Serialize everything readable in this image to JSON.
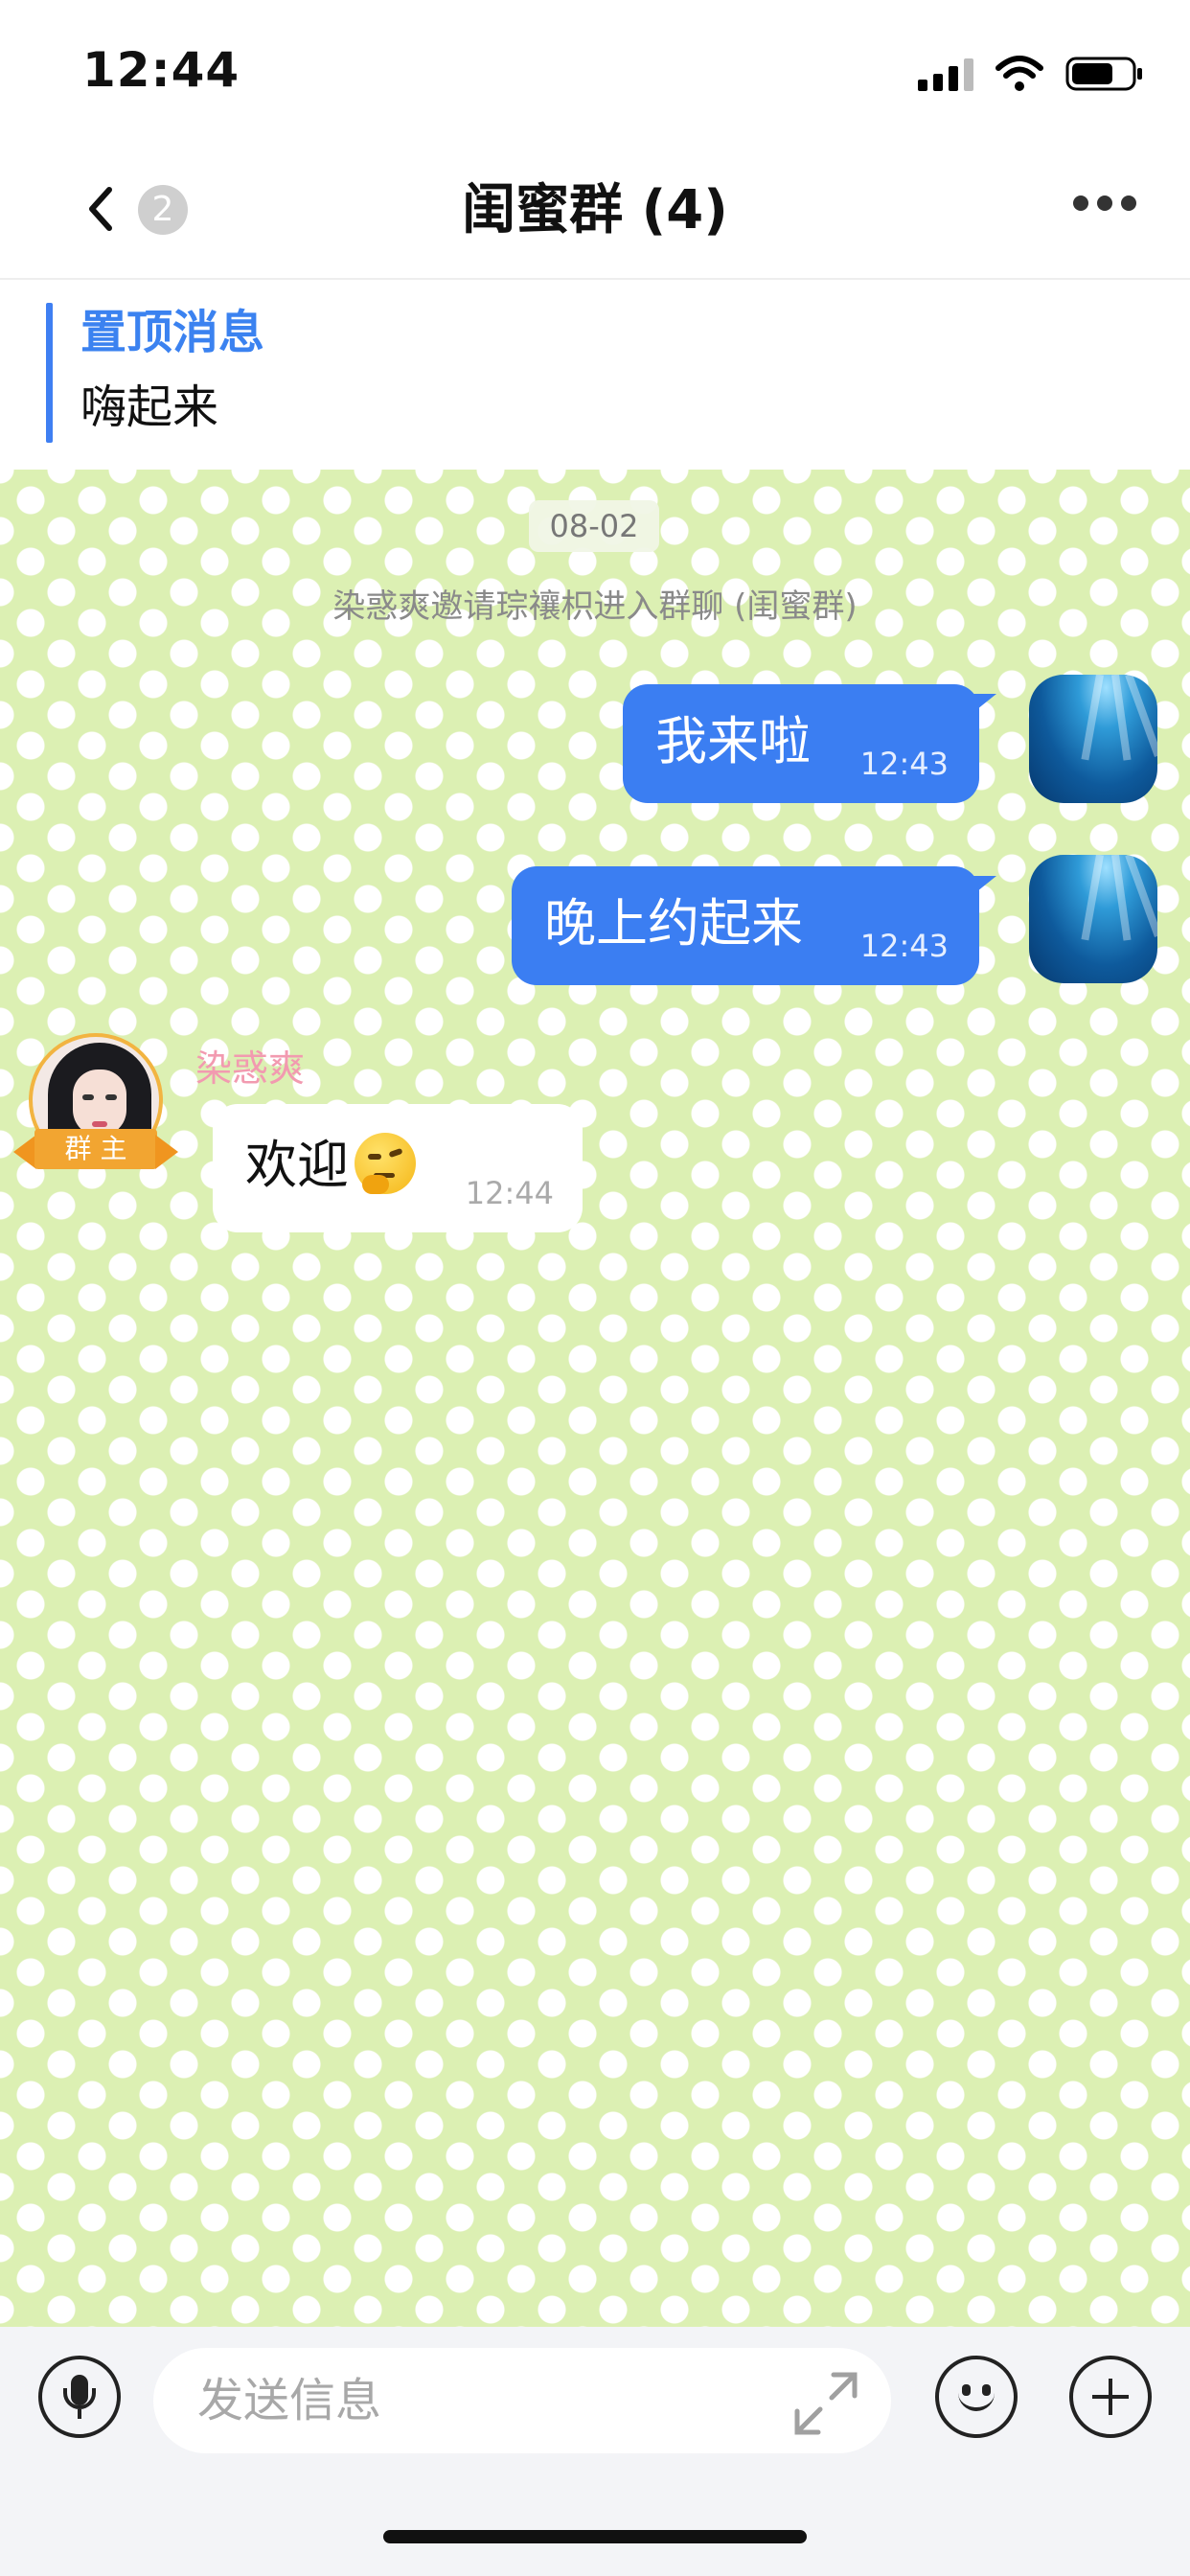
{
  "status_bar": {
    "time": "12:44"
  },
  "nav": {
    "unread_count": "2",
    "title": "闺蜜群 (4)"
  },
  "pinned": {
    "title": "置顶消息",
    "text": "嗨起来"
  },
  "chat": {
    "date": "08-02",
    "system_message": "染惑爽邀请琮禳枳进入群聊 (闺蜜群)",
    "outgoing": [
      {
        "text": "我来啦",
        "time": "12:43"
      },
      {
        "text": "晚上约起来",
        "time": "12:43"
      }
    ],
    "incoming": {
      "sender": "染惑爽",
      "role_badge": "群 主",
      "text": "欢迎",
      "emoji": "thinking-face-icon",
      "time": "12:44"
    }
  },
  "input": {
    "placeholder": "发送信息"
  },
  "colors": {
    "accent": "#3b7ef2",
    "chat_bg": "#dcf0b3",
    "sender_name": "#f29ab0",
    "owner_badge": "#f2a531"
  }
}
